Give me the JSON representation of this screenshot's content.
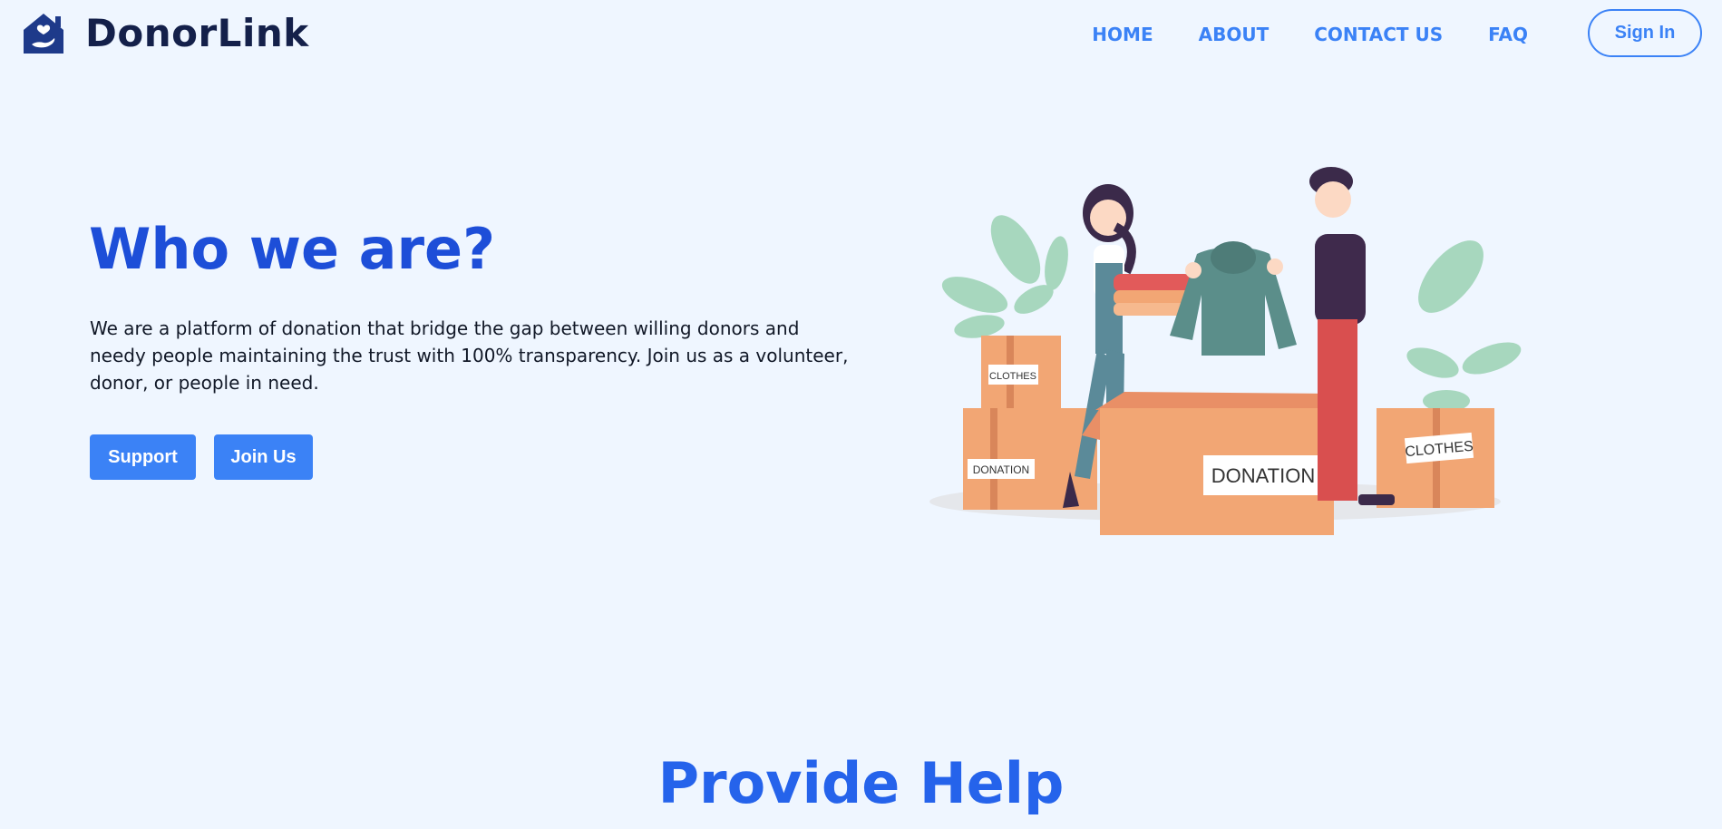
{
  "brand": {
    "name": "DonorLink"
  },
  "nav": {
    "links": [
      "HOME",
      "ABOUT",
      "CONTACT US",
      "FAQ"
    ],
    "sign_in": "Sign In"
  },
  "hero": {
    "title": "Who we are?",
    "description": "We are a platform of donation that bridge the gap between willing donors and needy people maintaining the trust with 100% transparency. Join us as a volunteer, donor, or people in need.",
    "support_label": "Support",
    "join_label": "Join Us"
  },
  "illustration": {
    "box_labels": [
      "CLOTHES",
      "DONATION",
      "DONATION",
      "CLOTHES"
    ]
  },
  "sections": {
    "provide_help_title": "Provide Help"
  },
  "colors": {
    "background": "#eff6ff",
    "primary": "#3b82f6",
    "heading": "#1d4ed8",
    "brand_text": "#14204a"
  }
}
